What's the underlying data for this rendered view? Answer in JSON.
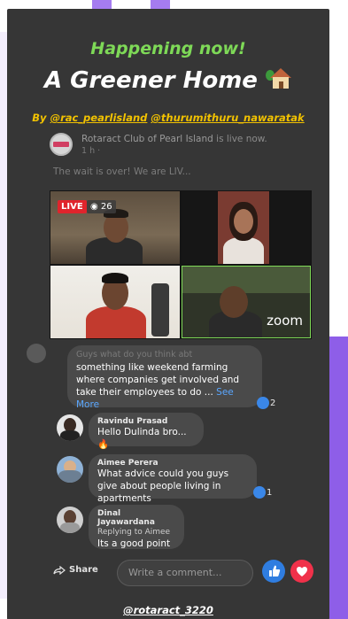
{
  "header": {
    "kicker": "Happening now!",
    "title": "A Greener Home",
    "byline_prefix": "By",
    "handle_1": "@rac_pearlisland",
    "handle_2": "@thurumithuru_nawaratak"
  },
  "post": {
    "page_name": "Rotaract Club of Pearl Island",
    "status": "is live now.",
    "time": "1 h",
    "text": "The wait is over! We are LIV..."
  },
  "live": {
    "badge": "LIVE",
    "viewers": "26",
    "zoom_label": "zoom"
  },
  "comments": [
    {
      "name": "",
      "text_faded": "Guys what do you think abt",
      "text": "something like weekend farming where companies get involved and take their employees to do ...",
      "see_more": "See More",
      "reactions": "2"
    },
    {
      "name": "Ravindu Prasad",
      "text": "Hello Dulinda bro...🔥",
      "reactions": ""
    },
    {
      "name": "Aimee Perera",
      "text": "What advice could you guys give about people living in apartments",
      "reactions": "1"
    },
    {
      "name": "Dinal Jayawardana",
      "reply_to": "Replying to Aimee",
      "text": "Its a good point",
      "reactions": ""
    }
  ],
  "composer": {
    "share_label": "Share",
    "placeholder": "Write a comment..."
  },
  "footer": {
    "handle": "@rotaract_3220"
  },
  "colors": {
    "kicker": "#7ed957",
    "byline": "#f2c200",
    "story_bg": "#363636",
    "accent_purple": "#8e5ee8",
    "live_red": "#e0242c",
    "like_blue": "#2f7de0",
    "heart_red": "#f0314a"
  }
}
